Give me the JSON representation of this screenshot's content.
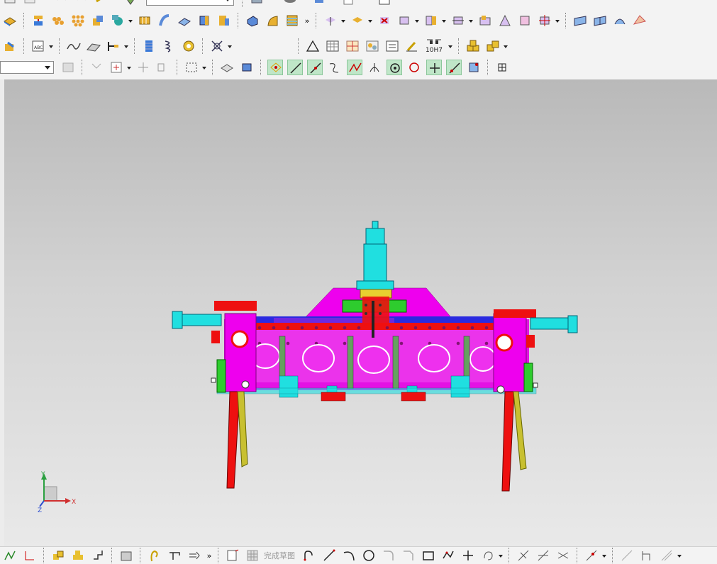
{
  "toolbar": {
    "row1_icons": [
      "extrude-icon",
      "feature-stack-icon",
      "pattern-feature-icon",
      "pattern-body-icon",
      "boolean-icon",
      "shell-icon",
      "sweep-icon",
      "face-icon",
      "surface-icon",
      "block-icon",
      "body-icon",
      "fillet-icon",
      "chamfer-icon",
      "texture-icon"
    ],
    "row1_right_icons": [
      "synchronous-move-icon",
      "replace-face-icon",
      "delete-face-icon",
      "offset-region-icon",
      "pull-face-icon",
      "resize-icon",
      "pattern-face-icon",
      "offset-face-icon",
      "copy-face-icon",
      "move-face-icon",
      "surface-grid-icon",
      "studio-surface-icon",
      "swept-surface-icon",
      "n-sided-surface-icon"
    ],
    "row2_icons": [
      "assembly-icon",
      "annotation-icon",
      "curve-icon",
      "surface-curve-icon",
      "dimension-icon",
      "spring-icon",
      "coil-icon",
      "ring-icon",
      "helix-icon"
    ],
    "row2_right_icons": [
      "triangle-icon",
      "table-icon",
      "grid-icon",
      "gear-icon",
      "note-icon",
      "brush-icon",
      "tolerance-icon",
      "cube-stack-icon",
      "cube-pair-icon"
    ],
    "tolerance_label": "10H7",
    "row3_icons": [
      "filter-icon",
      "snap-icon",
      "point-icon",
      "selection-icon",
      "box-select-icon",
      "view-icon",
      "shaded-icon",
      "snap-endpoint-icon",
      "line-icon",
      "intersection-icon",
      "curve-point-icon",
      "tangent-icon",
      "midpoint-icon",
      "center-icon",
      "quadrant-icon",
      "existing-point-icon",
      "on-curve-icon",
      "bounded-icon",
      "grid-snap-icon"
    ],
    "selection_filter_value": ""
  },
  "bottombar": {
    "finish_sketch_label": "完成草图",
    "icons": [
      "more-left-icon",
      "assembly-tree-icon",
      "component-icon",
      "constraint-icon",
      "part-icon",
      "lasso-icon",
      "pipe-icon",
      "route-icon",
      "sketch-icon",
      "grid-icon",
      "profile-icon",
      "line-icon",
      "arc-icon",
      "circle-icon",
      "fillet-icon",
      "chamfer-icon",
      "rectangle-icon",
      "polygon-icon",
      "point-icon",
      "offset-icon",
      "trim-icon",
      "extend-icon",
      "mirror-icon",
      "pattern-icon",
      "dimension-icon",
      "constraint-icon",
      "dimension-icon",
      "constraint-icon"
    ]
  },
  "triad": {
    "x_label": "X",
    "y_label": "Y",
    "z_label": "Z"
  },
  "colors": {
    "viewport_top": "#b9b9b9",
    "viewport_bottom": "#e9e9e9",
    "model_magenta": "#ee00ee",
    "model_red": "#ee1010",
    "model_cyan": "#20dfe0",
    "model_green": "#2ecc2e",
    "model_yellow": "#e8d030",
    "model_blue": "#2020e0"
  }
}
